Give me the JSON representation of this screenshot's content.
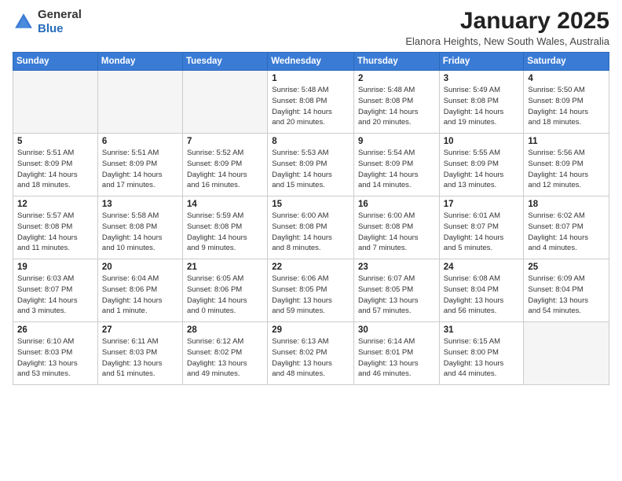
{
  "header": {
    "logo_general": "General",
    "logo_blue": "Blue",
    "month_title": "January 2025",
    "location": "Elanora Heights, New South Wales, Australia"
  },
  "weekdays": [
    "Sunday",
    "Monday",
    "Tuesday",
    "Wednesday",
    "Thursday",
    "Friday",
    "Saturday"
  ],
  "weeks": [
    [
      {
        "day": "",
        "info": ""
      },
      {
        "day": "",
        "info": ""
      },
      {
        "day": "",
        "info": ""
      },
      {
        "day": "1",
        "info": "Sunrise: 5:48 AM\nSunset: 8:08 PM\nDaylight: 14 hours\nand 20 minutes."
      },
      {
        "day": "2",
        "info": "Sunrise: 5:48 AM\nSunset: 8:08 PM\nDaylight: 14 hours\nand 20 minutes."
      },
      {
        "day": "3",
        "info": "Sunrise: 5:49 AM\nSunset: 8:08 PM\nDaylight: 14 hours\nand 19 minutes."
      },
      {
        "day": "4",
        "info": "Sunrise: 5:50 AM\nSunset: 8:09 PM\nDaylight: 14 hours\nand 18 minutes."
      }
    ],
    [
      {
        "day": "5",
        "info": "Sunrise: 5:51 AM\nSunset: 8:09 PM\nDaylight: 14 hours\nand 18 minutes."
      },
      {
        "day": "6",
        "info": "Sunrise: 5:51 AM\nSunset: 8:09 PM\nDaylight: 14 hours\nand 17 minutes."
      },
      {
        "day": "7",
        "info": "Sunrise: 5:52 AM\nSunset: 8:09 PM\nDaylight: 14 hours\nand 16 minutes."
      },
      {
        "day": "8",
        "info": "Sunrise: 5:53 AM\nSunset: 8:09 PM\nDaylight: 14 hours\nand 15 minutes."
      },
      {
        "day": "9",
        "info": "Sunrise: 5:54 AM\nSunset: 8:09 PM\nDaylight: 14 hours\nand 14 minutes."
      },
      {
        "day": "10",
        "info": "Sunrise: 5:55 AM\nSunset: 8:09 PM\nDaylight: 14 hours\nand 13 minutes."
      },
      {
        "day": "11",
        "info": "Sunrise: 5:56 AM\nSunset: 8:09 PM\nDaylight: 14 hours\nand 12 minutes."
      }
    ],
    [
      {
        "day": "12",
        "info": "Sunrise: 5:57 AM\nSunset: 8:08 PM\nDaylight: 14 hours\nand 11 minutes."
      },
      {
        "day": "13",
        "info": "Sunrise: 5:58 AM\nSunset: 8:08 PM\nDaylight: 14 hours\nand 10 minutes."
      },
      {
        "day": "14",
        "info": "Sunrise: 5:59 AM\nSunset: 8:08 PM\nDaylight: 14 hours\nand 9 minutes."
      },
      {
        "day": "15",
        "info": "Sunrise: 6:00 AM\nSunset: 8:08 PM\nDaylight: 14 hours\nand 8 minutes."
      },
      {
        "day": "16",
        "info": "Sunrise: 6:00 AM\nSunset: 8:08 PM\nDaylight: 14 hours\nand 7 minutes."
      },
      {
        "day": "17",
        "info": "Sunrise: 6:01 AM\nSunset: 8:07 PM\nDaylight: 14 hours\nand 5 minutes."
      },
      {
        "day": "18",
        "info": "Sunrise: 6:02 AM\nSunset: 8:07 PM\nDaylight: 14 hours\nand 4 minutes."
      }
    ],
    [
      {
        "day": "19",
        "info": "Sunrise: 6:03 AM\nSunset: 8:07 PM\nDaylight: 14 hours\nand 3 minutes."
      },
      {
        "day": "20",
        "info": "Sunrise: 6:04 AM\nSunset: 8:06 PM\nDaylight: 14 hours\nand 1 minute."
      },
      {
        "day": "21",
        "info": "Sunrise: 6:05 AM\nSunset: 8:06 PM\nDaylight: 14 hours\nand 0 minutes."
      },
      {
        "day": "22",
        "info": "Sunrise: 6:06 AM\nSunset: 8:05 PM\nDaylight: 13 hours\nand 59 minutes."
      },
      {
        "day": "23",
        "info": "Sunrise: 6:07 AM\nSunset: 8:05 PM\nDaylight: 13 hours\nand 57 minutes."
      },
      {
        "day": "24",
        "info": "Sunrise: 6:08 AM\nSunset: 8:04 PM\nDaylight: 13 hours\nand 56 minutes."
      },
      {
        "day": "25",
        "info": "Sunrise: 6:09 AM\nSunset: 8:04 PM\nDaylight: 13 hours\nand 54 minutes."
      }
    ],
    [
      {
        "day": "26",
        "info": "Sunrise: 6:10 AM\nSunset: 8:03 PM\nDaylight: 13 hours\nand 53 minutes."
      },
      {
        "day": "27",
        "info": "Sunrise: 6:11 AM\nSunset: 8:03 PM\nDaylight: 13 hours\nand 51 minutes."
      },
      {
        "day": "28",
        "info": "Sunrise: 6:12 AM\nSunset: 8:02 PM\nDaylight: 13 hours\nand 49 minutes."
      },
      {
        "day": "29",
        "info": "Sunrise: 6:13 AM\nSunset: 8:02 PM\nDaylight: 13 hours\nand 48 minutes."
      },
      {
        "day": "30",
        "info": "Sunrise: 6:14 AM\nSunset: 8:01 PM\nDaylight: 13 hours\nand 46 minutes."
      },
      {
        "day": "31",
        "info": "Sunrise: 6:15 AM\nSunset: 8:00 PM\nDaylight: 13 hours\nand 44 minutes."
      },
      {
        "day": "",
        "info": ""
      }
    ]
  ]
}
